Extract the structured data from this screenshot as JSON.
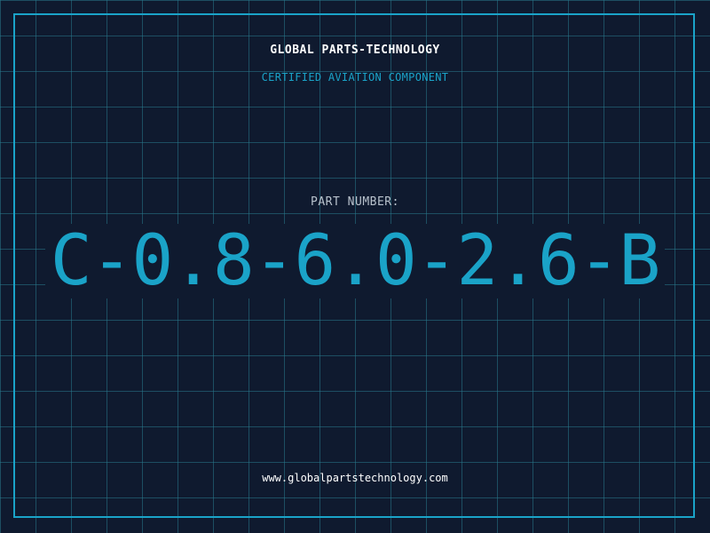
{
  "header": {
    "company": "GLOBAL PARTS-TECHNOLOGY",
    "subtitle": "CERTIFIED AVIATION COMPONENT"
  },
  "part": {
    "label": "PART NUMBER:",
    "number": "C-0.8-6.0-2.6-B"
  },
  "footer": {
    "website": "www.globalpartstechnology.com"
  },
  "colors": {
    "background": "#0f1a2f",
    "accent": "#1aa3c8",
    "grid": "#28788c",
    "text": "#ffffff",
    "label": "#b8c2cc"
  }
}
